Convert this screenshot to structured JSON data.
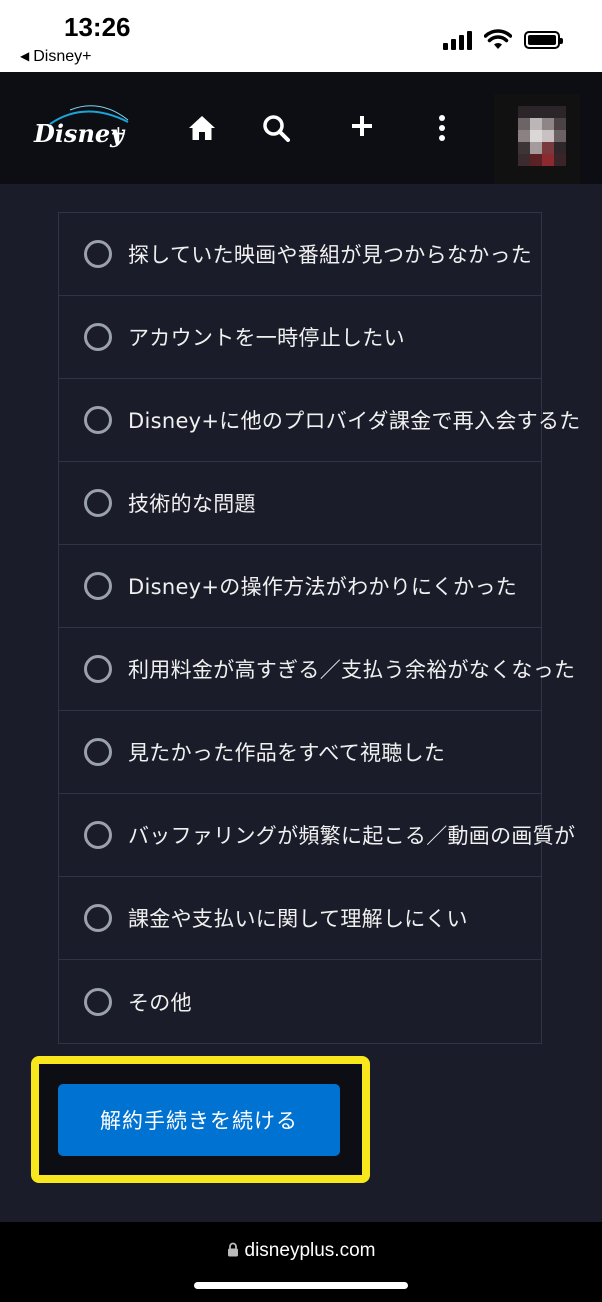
{
  "status_bar": {
    "time": "13:26",
    "back_app": "Disney+"
  },
  "header": {
    "logo_text": "Disney+",
    "icons": [
      "home-icon",
      "search-icon",
      "plus-icon",
      "more-vertical-icon"
    ]
  },
  "reasons": [
    "探していた映画や番組が見つからなかった",
    "アカウントを一時停止したい",
    "Disney+に他のプロバイダ課金で再入会するた",
    "技術的な問題",
    "Disney+の操作方法がわかりにくかった",
    "利用料金が高すぎる／支払う余裕がなくなった",
    "見たかった作品をすべて視聴した",
    "バッファリングが頻繁に起こる／動画の画質が",
    "課金や支払いに関して理解しにくい",
    "その他"
  ],
  "continue_button": "解約手続きを続ける",
  "browser": {
    "url": "disneyplus.com"
  },
  "colors": {
    "background": "#1a1d29",
    "header": "#0d0e13",
    "button": "#0072d2",
    "highlight": "#f8e71c"
  }
}
